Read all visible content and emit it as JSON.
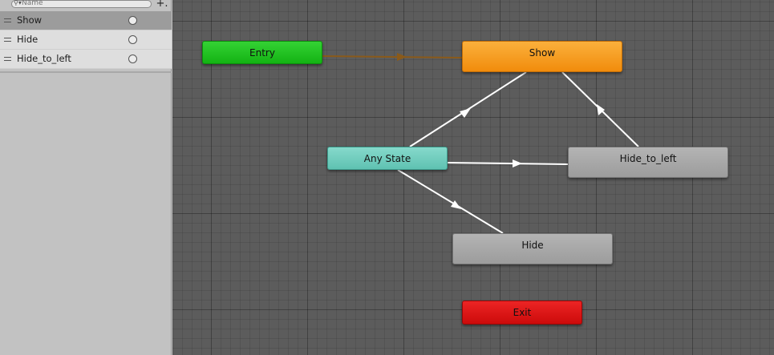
{
  "parameters_panel": {
    "search": {
      "placeholder": "Name",
      "icon": "search-icon"
    },
    "add_button": {
      "label": "+.",
      "icon": "plus-icon"
    },
    "items": [
      {
        "label": "Show",
        "selected": true
      },
      {
        "label": "Hide",
        "selected": false
      },
      {
        "label": "Hide_to_left",
        "selected": false
      }
    ]
  },
  "graph": {
    "states": {
      "entry": {
        "label": "Entry",
        "color": "#1fc11f"
      },
      "show": {
        "label": "Show",
        "color": "#f5a020"
      },
      "any_state": {
        "label": "Any State",
        "color": "#6fcfbf"
      },
      "hide_to_left": {
        "label": "Hide_to_left",
        "color": "#a8a8a8"
      },
      "hide": {
        "label": "Hide",
        "color": "#a8a8a8"
      },
      "exit": {
        "label": "Exit",
        "color": "#dd1414"
      }
    },
    "transitions": [
      {
        "from": "Entry",
        "to": "Show",
        "color": "#8a5a1a"
      },
      {
        "from": "Any State",
        "to": "Show",
        "color": "#ffffff"
      },
      {
        "from": "Any State",
        "to": "Hide_to_left",
        "color": "#ffffff"
      },
      {
        "from": "Any State",
        "to": "Hide",
        "color": "#ffffff"
      },
      {
        "from": "Hide_to_left",
        "to": "Show",
        "color": "#ffffff"
      }
    ]
  }
}
